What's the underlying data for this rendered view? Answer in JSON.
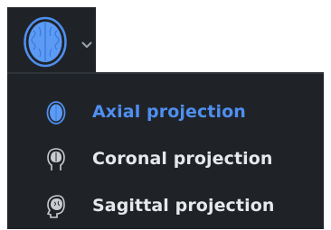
{
  "projection_selector": {
    "button_icon": "brain-axial-icon",
    "chevron_icon": "chevron-down-icon",
    "items": [
      {
        "label": "Axial projection",
        "icon": "axial-head-icon",
        "selected": true
      },
      {
        "label": "Coronal projection",
        "icon": "coronal-head-icon",
        "selected": false
      },
      {
        "label": "Sagittal projection",
        "icon": "sagittal-head-icon",
        "selected": false
      }
    ]
  },
  "colors": {
    "panel_bg": "#1f2328",
    "accent": "#4f8ff0",
    "text": "#e6e8ea",
    "icon_gray": "#c9cdd1"
  }
}
